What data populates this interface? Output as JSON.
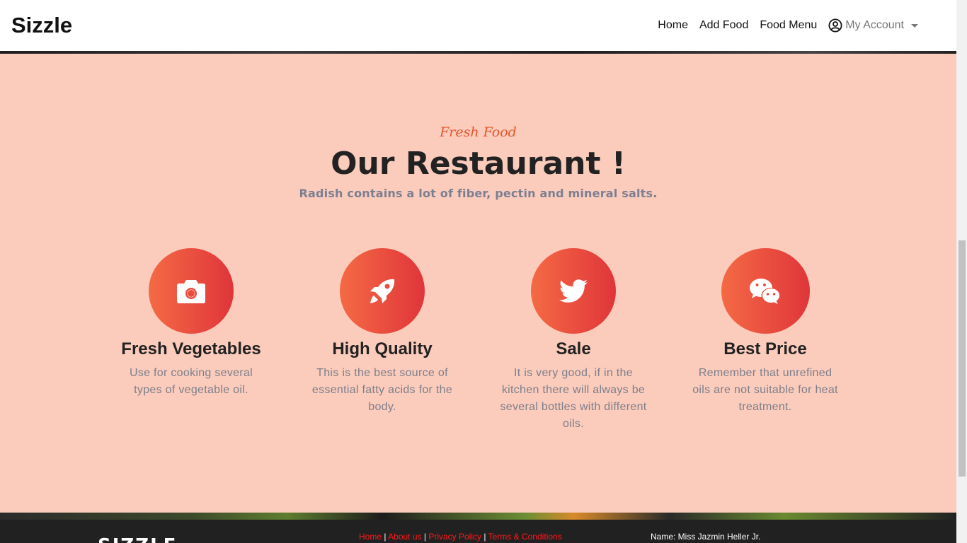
{
  "navbar": {
    "brand": "Sizzle",
    "links": [
      "Home",
      "Add Food",
      "Food Menu"
    ],
    "account_label": "My Account"
  },
  "section": {
    "kicker": "Fresh Food",
    "title": "Our Restaurant !",
    "subtitle": "Radish contains a lot of fiber, pectin and mineral salts."
  },
  "features": [
    {
      "icon": "camera-icon",
      "title": "Fresh Vegetables",
      "text_lines": [
        "Use for cooking several",
        "types of vegetable oil."
      ]
    },
    {
      "icon": "rocket-icon",
      "title": "High Quality",
      "text_lines": [
        "This is the best source of",
        "essential fatty acids for the",
        "body."
      ]
    },
    {
      "icon": "twitter-icon",
      "title": "Sale",
      "text_lines": [
        "It is very good, if in the",
        "kitchen there will always be",
        "several bottles with different",
        "oils."
      ]
    },
    {
      "icon": "wechat-icon",
      "title": "Best Price",
      "text_lines": [
        "Remember that unrefined",
        "oils are not suitable for heat",
        "treatment."
      ]
    }
  ],
  "footer": {
    "logo": "SIZZLE",
    "links": [
      "Home",
      "About us",
      "Privacy Policy",
      "Terms & Conditions"
    ],
    "separator": "|",
    "name_line": "Name: Miss Jazmin Heller Jr."
  },
  "colors": {
    "accent": "#e4572e",
    "gradient_start": "#f46a45",
    "gradient_end": "#e0353a",
    "section_bg": "#fbcbbb",
    "footer_link": "#ff1a1a"
  }
}
